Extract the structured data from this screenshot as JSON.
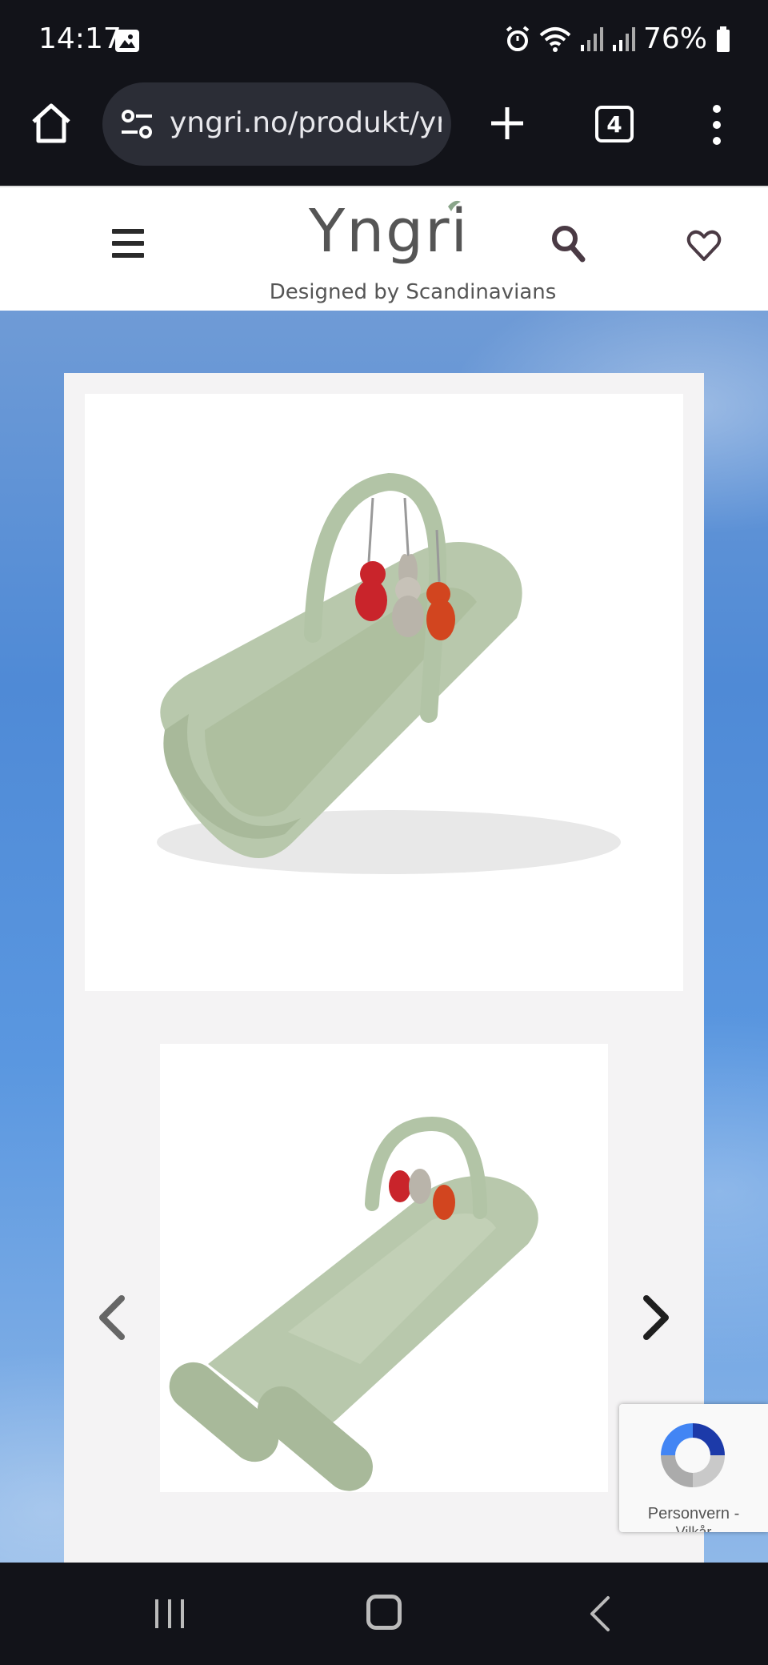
{
  "status_bar": {
    "time": "14:17",
    "battery": "76%",
    "icons": [
      "image-icon",
      "alarm-icon",
      "wifi-icon",
      "signal-icon",
      "signal-icon",
      "battery-icon"
    ]
  },
  "browser": {
    "url": "yngri.no/produkt/yr",
    "tab_count": "4"
  },
  "site": {
    "logo": "Yngri",
    "tagline": "Designed by Scandinavians"
  },
  "gallery": {
    "main_image_alt": "baby-nest-with-play-arch",
    "thumb_image_alt": "baby-nest-unfolded-with-play-arch"
  },
  "recaptcha": {
    "text": "Personvern -",
    "sub": "Vilkår"
  },
  "colors": {
    "product_green": "#b7c7ab",
    "toy_red": "#c9242b",
    "toy_orange": "#d2451f",
    "toy_grey": "#b9b4aa",
    "sky_blue": "#4f8ad6"
  }
}
